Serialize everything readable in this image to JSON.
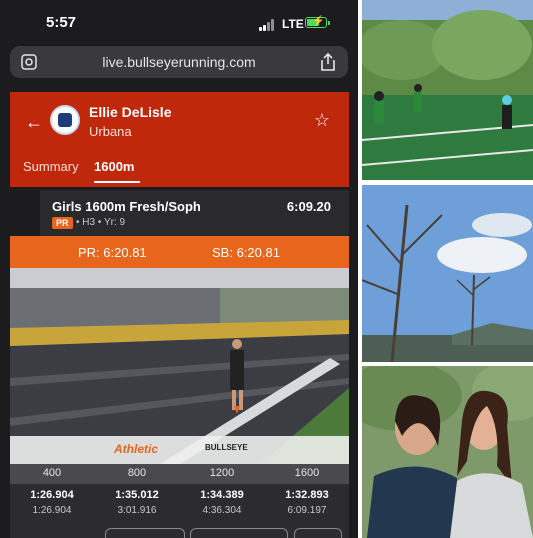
{
  "status_bar": {
    "time": "5:57",
    "network": "LTE"
  },
  "browser": {
    "url": "live.bullseyerunning.com"
  },
  "athlete": {
    "name": "Ellie DeLisle",
    "school": "Urbana"
  },
  "tabs": [
    {
      "label": "Summary",
      "active": false
    },
    {
      "label": "1600m",
      "active": true
    }
  ],
  "event": {
    "name": "Girls 1600m Fresh/Soph",
    "time": "6:09.20",
    "badge": "PR",
    "meta": "• H3 • Yr: 9"
  },
  "records": {
    "pr": "PR: 6:20.81",
    "sb": "SB: 6:20.81"
  },
  "photo_logos": {
    "athletic": "Athletic",
    "bullseye": "BULLSEYE"
  },
  "splits": {
    "headers": [
      "400",
      "800",
      "1200",
      "1600"
    ],
    "laps": [
      "1:26.904",
      "1:35.012",
      "1:34.389",
      "1:32.893"
    ],
    "cumulative": [
      "1:26.904",
      "3:01.916",
      "4:36.304",
      "6:09.197"
    ]
  },
  "colors": {
    "header_red": "#c0280c",
    "records_orange": "#e8661c",
    "pr_badge": "#e8651f"
  }
}
